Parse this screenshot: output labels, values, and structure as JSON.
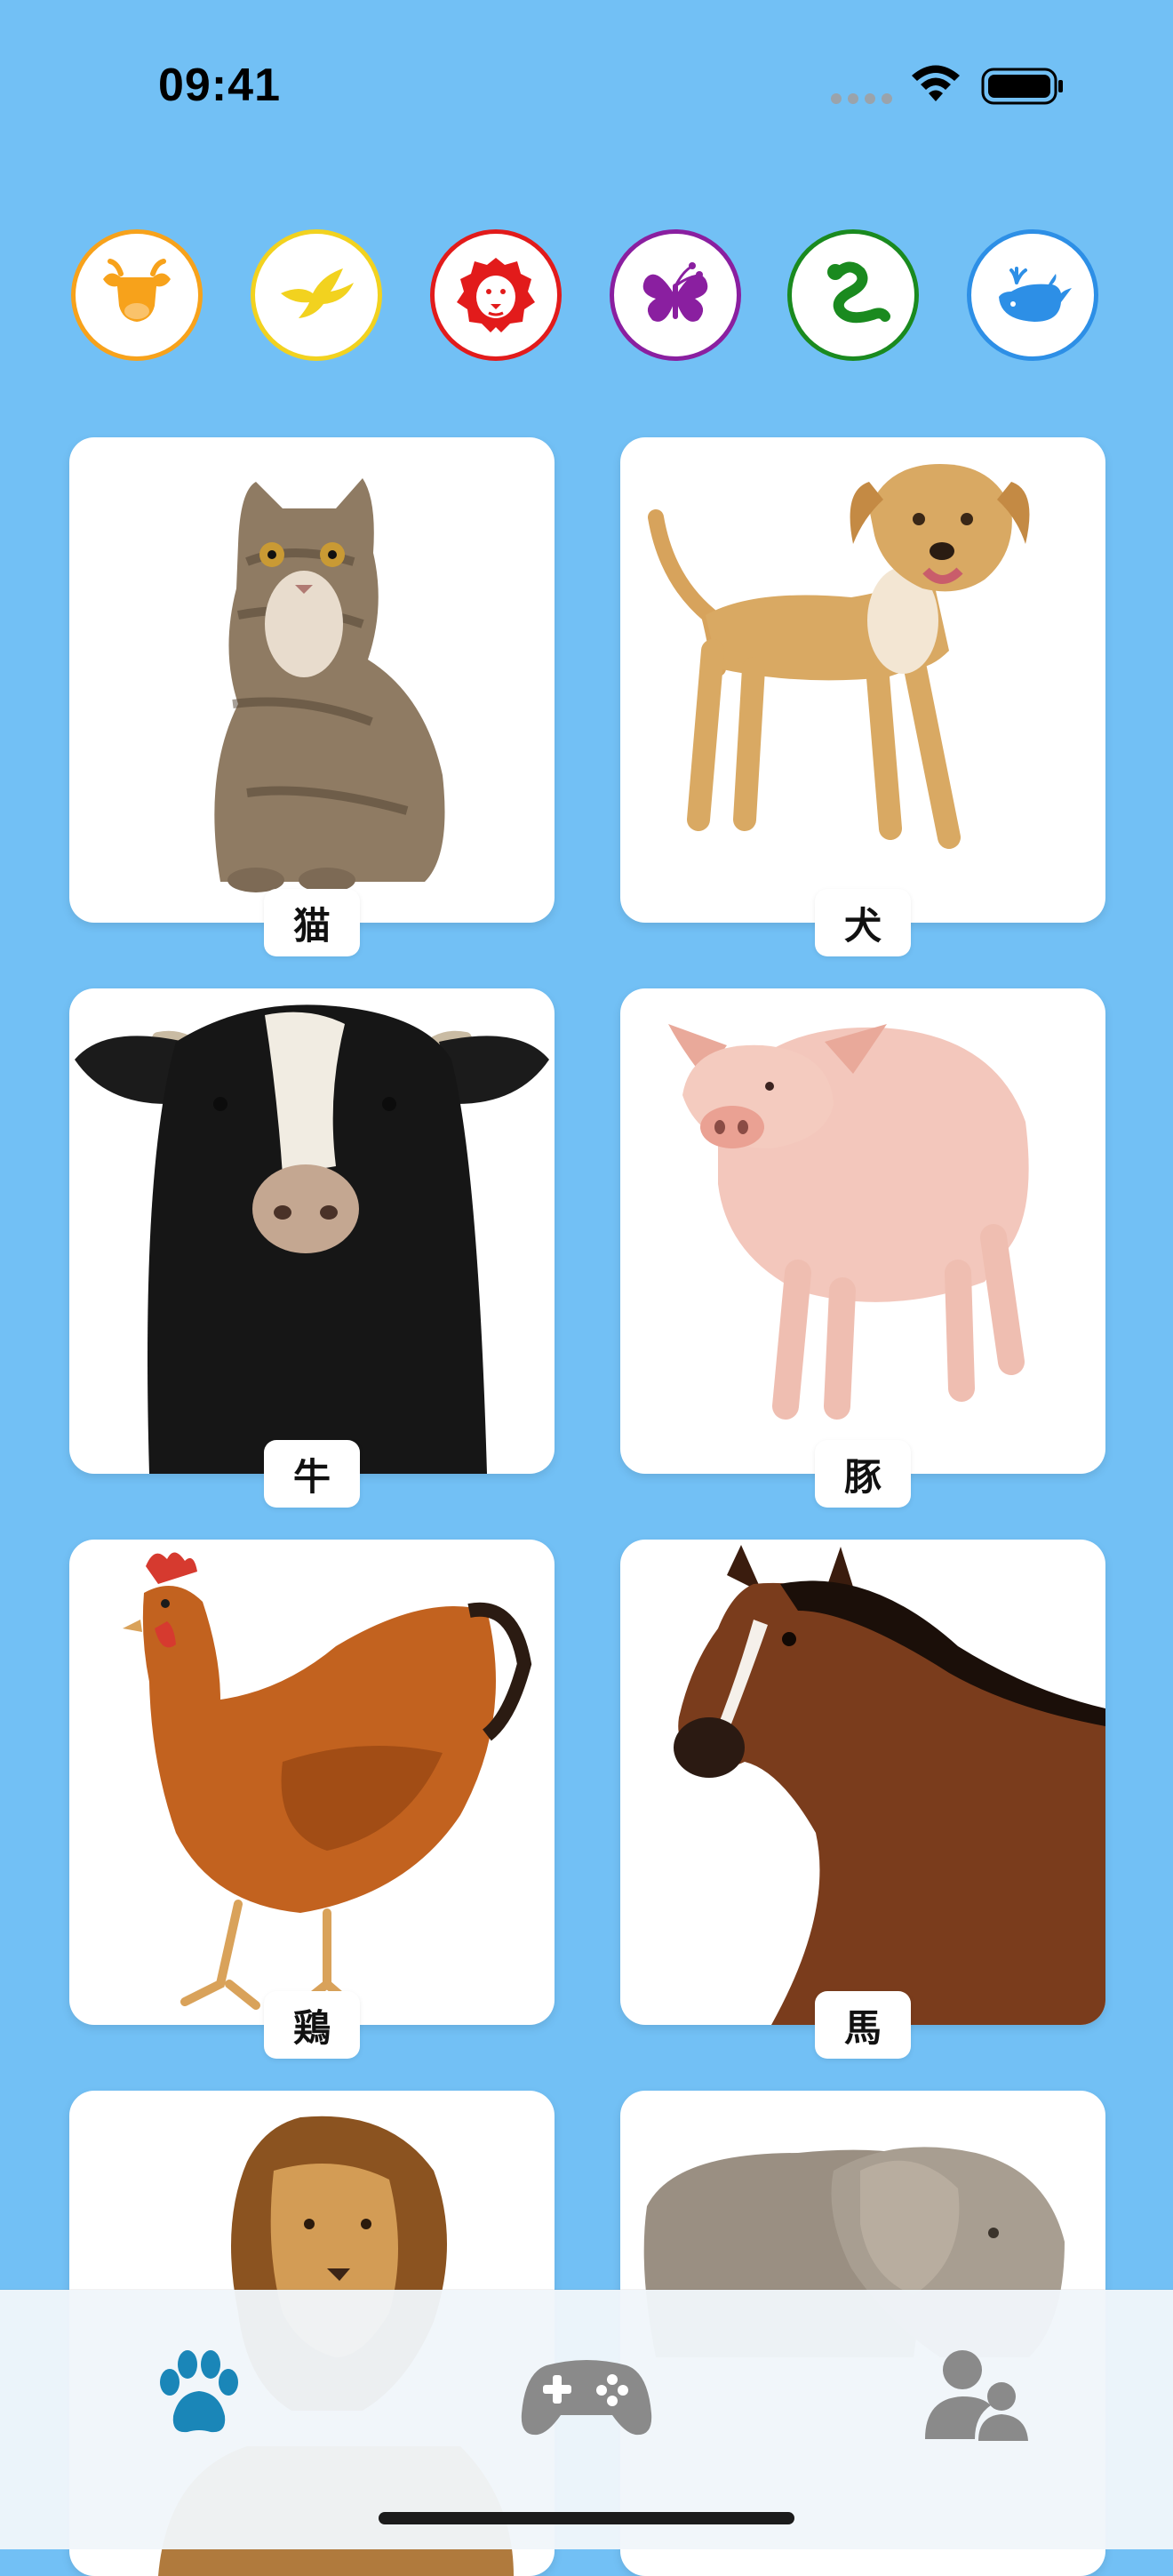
{
  "status": {
    "time": "09:41"
  },
  "categories": [
    {
      "name": "farm",
      "icon": "cow-head-icon",
      "color": "#f7a21b"
    },
    {
      "name": "birds",
      "icon": "bird-icon",
      "color": "#f2d21f"
    },
    {
      "name": "wild",
      "icon": "lion-head-icon",
      "color": "#e21b1b"
    },
    {
      "name": "insects",
      "icon": "butterfly-icon",
      "color": "#8a1fa0"
    },
    {
      "name": "reptiles",
      "icon": "snake-icon",
      "color": "#1a8a1f"
    },
    {
      "name": "sea",
      "icon": "whale-icon",
      "color": "#2d8fe6"
    }
  ],
  "animals": [
    {
      "label": "猫",
      "image": "cat-photo"
    },
    {
      "label": "犬",
      "image": "dog-photo"
    },
    {
      "label": "牛",
      "image": "cow-photo"
    },
    {
      "label": "豚",
      "image": "pig-photo"
    },
    {
      "label": "鶏",
      "image": "chicken-photo"
    },
    {
      "label": "馬",
      "image": "horse-photo"
    },
    {
      "label": "",
      "image": "lion-photo"
    },
    {
      "label": "",
      "image": "elephant-photo"
    }
  ],
  "tabs": [
    {
      "icon": "paw-icon",
      "selected": true,
      "color": "#1a86b8"
    },
    {
      "icon": "gamepad-icon",
      "selected": false,
      "color": "#8a8a8a"
    },
    {
      "icon": "users-icon",
      "selected": false,
      "color": "#8a8a8a"
    }
  ]
}
